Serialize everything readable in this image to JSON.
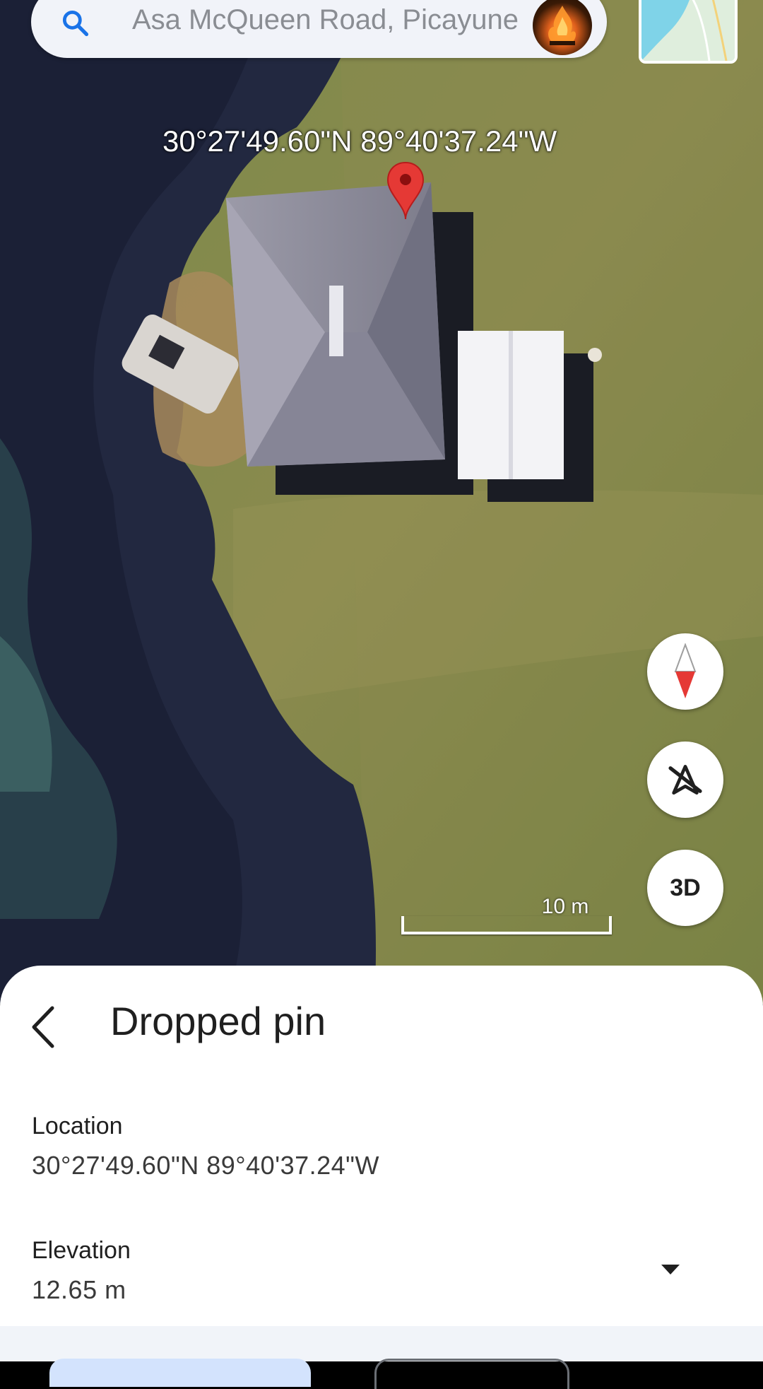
{
  "search": {
    "text": "Asa McQueen Road, Picayune"
  },
  "map": {
    "coordinates_label": "30°27'49.60\"N 89°40'37.24\"W",
    "scale_label": "10 m"
  },
  "controls": {
    "compass_icon": "compass-icon",
    "tilt_icon": "tilt-off-icon",
    "three_d_label": "3D"
  },
  "sheet": {
    "title": "Dropped pin",
    "location_label": "Location",
    "location_value": "30°27'49.60\"N 89°40'37.24\"W",
    "elevation_label": "Elevation",
    "elevation_value": "12.65 m"
  },
  "colors": {
    "pin": "#e53935",
    "sheet_bg": "#ffffff",
    "search_bg": "#f1f3f9",
    "primary_chip": "#d3e3fd"
  }
}
